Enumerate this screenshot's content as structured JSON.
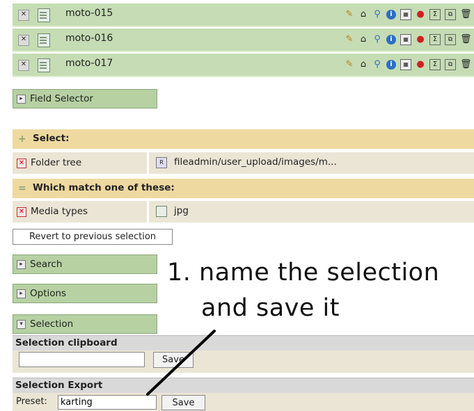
{
  "files": [
    {
      "name": "moto-015"
    },
    {
      "name": "moto-016"
    },
    {
      "name": "moto-017"
    }
  ],
  "row_action_icons": [
    "edit-icon",
    "tag-icon",
    "zoom-icon",
    "info-icon",
    "calendar-icon",
    "delete-red-icon",
    "sum-icon",
    "copy-icon",
    "trash-icon"
  ],
  "field_selector": {
    "label": "Field Selector"
  },
  "select_section": {
    "header": "Select:",
    "folder_tree": {
      "label": "Folder tree",
      "value": "fileadmin/user_upload/images/m..."
    }
  },
  "match_section": {
    "header": "Which match one of these:",
    "media_types": {
      "label": "Media types",
      "value": "jpg"
    }
  },
  "revert_button": "Revert to previous selection",
  "tabs": {
    "search": "Search",
    "options": "Options",
    "selection": "Selection"
  },
  "clipboard": {
    "header": "Selection clipboard",
    "input_value": "",
    "save_label": "Save"
  },
  "export": {
    "header": "Selection Export",
    "preset_label": "Preset:",
    "preset_value": "karting",
    "save_label": "Save"
  },
  "annotation": {
    "line1": "1. name the selection",
    "line2": "and save it"
  },
  "colors": {
    "row_green": "#c5dcb4",
    "tab_green": "#b7d1a3",
    "header_yellow": "#eed9a0",
    "row_beige": "#ebe5d6"
  }
}
